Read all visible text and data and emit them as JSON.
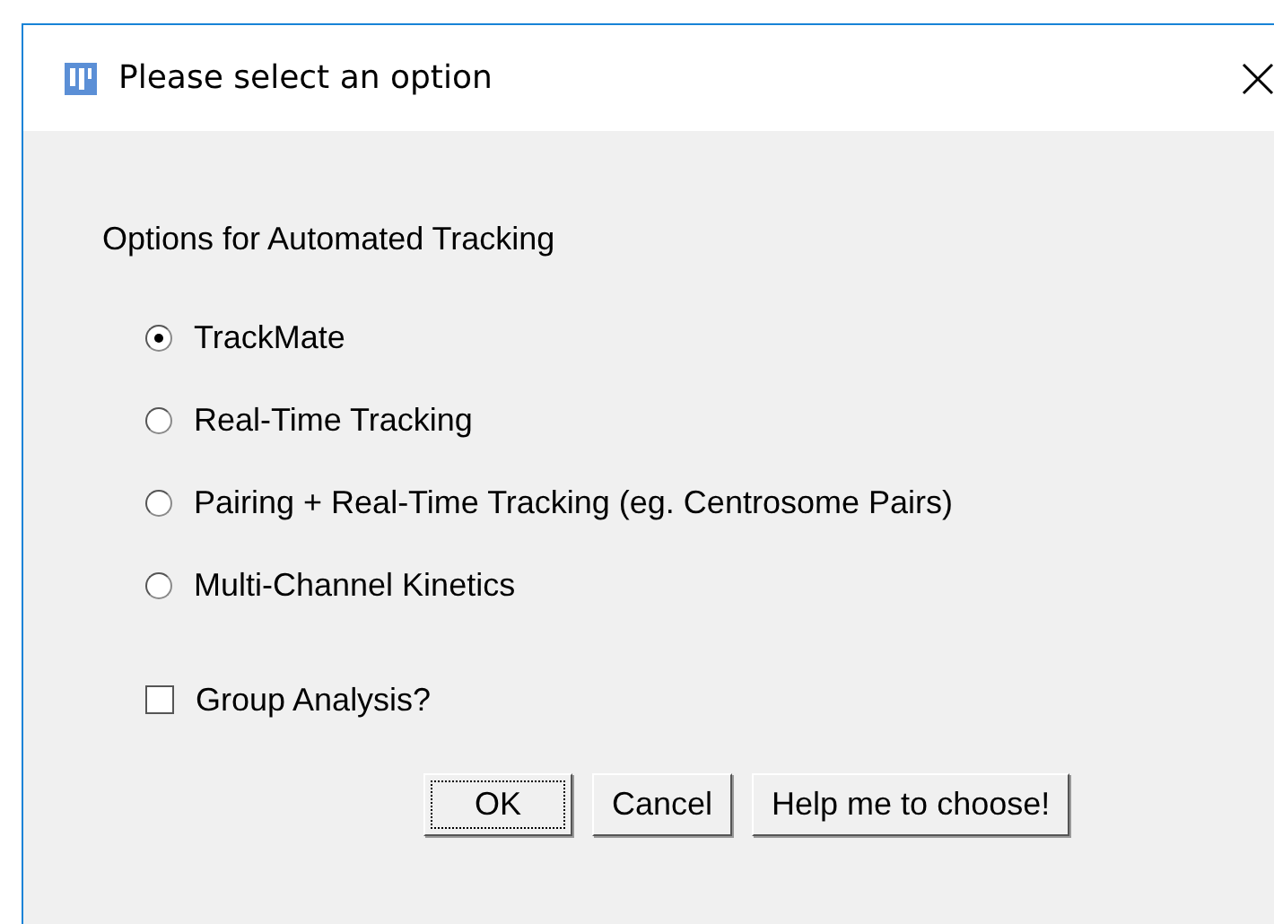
{
  "window": {
    "title": "Please select an option"
  },
  "heading": "Options for Automated Tracking",
  "options": [
    {
      "label": "TrackMate",
      "selected": true
    },
    {
      "label": "Real-Time Tracking",
      "selected": false
    },
    {
      "label": "Pairing + Real-Time Tracking (eg. Centrosome Pairs)",
      "selected": false
    },
    {
      "label": "Multi-Channel Kinetics",
      "selected": false
    }
  ],
  "group_analysis": {
    "label": "Group Analysis?",
    "checked": false
  },
  "buttons": [
    {
      "label": "OK",
      "focused": true
    },
    {
      "label": "Cancel",
      "focused": false
    },
    {
      "label": "Help me to choose!",
      "focused": false
    }
  ]
}
